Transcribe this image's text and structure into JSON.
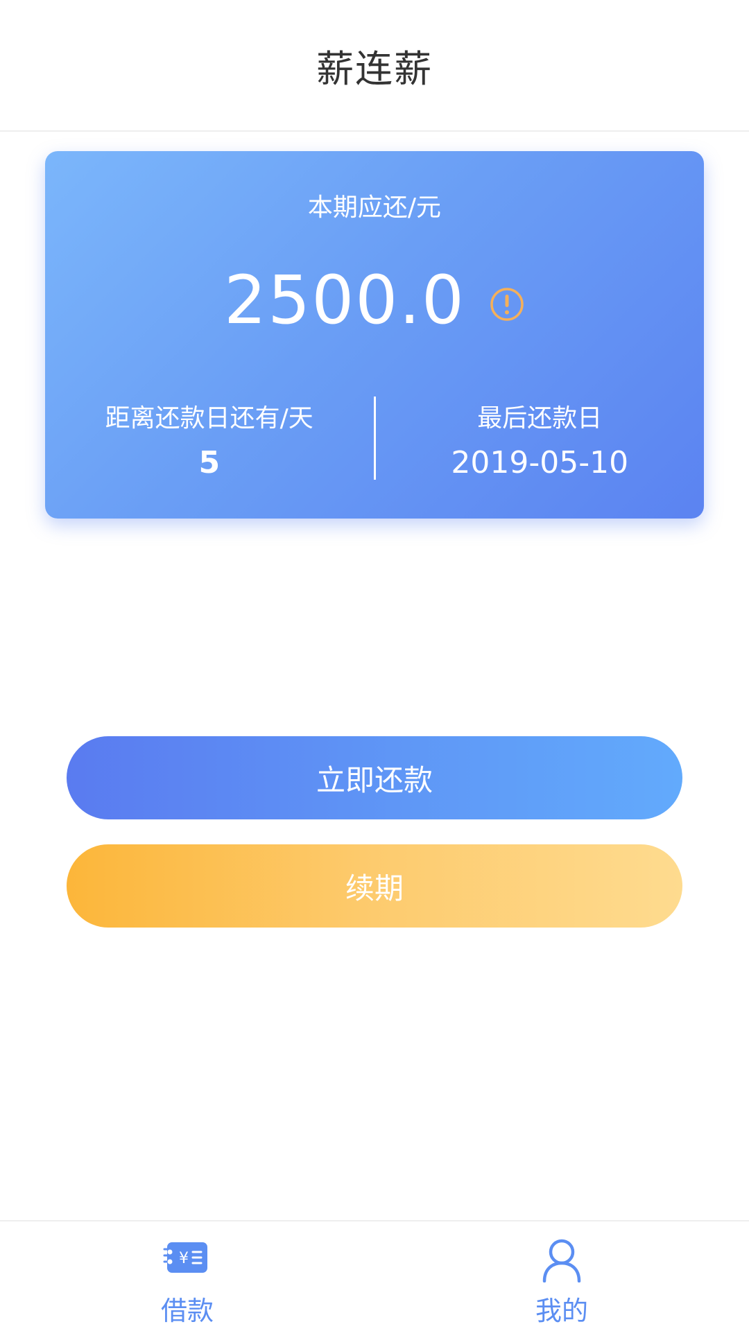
{
  "header": {
    "title": "薪连薪"
  },
  "card": {
    "amount_label": "本期应还/元",
    "amount": "2500.0",
    "days_label": "距离还款日还有/天",
    "days_value": "5",
    "due_label": "最后还款日",
    "due_value": "2019-05-10"
  },
  "actions": {
    "repay_label": "立即还款",
    "renew_label": "续期"
  },
  "bottom_nav": {
    "items": [
      {
        "label": "借款",
        "icon": "loan-icon"
      },
      {
        "label": "我的",
        "icon": "user-icon"
      }
    ]
  },
  "colors": {
    "accent_blue": "#5b83f1",
    "accent_orange": "#fcb63a",
    "warn": "#f5b05a"
  }
}
